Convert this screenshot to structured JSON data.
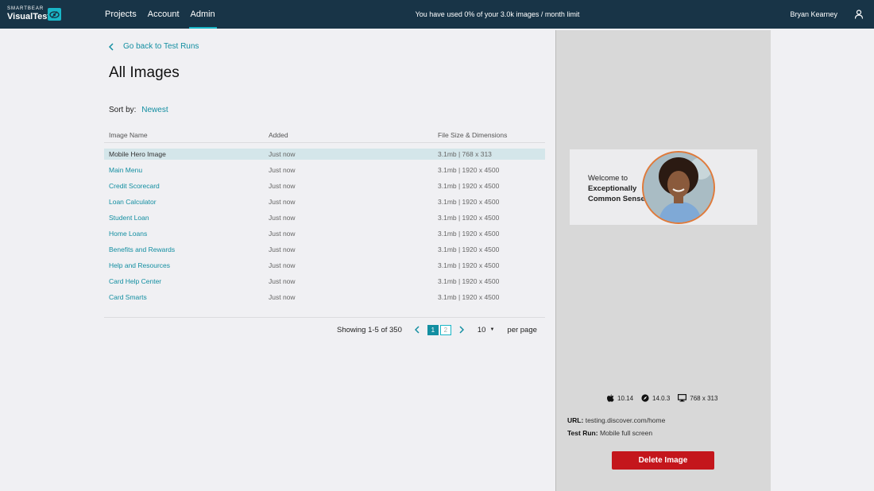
{
  "brand": {
    "small": "SMARTBEAR",
    "big": "VisualTest"
  },
  "nav": [
    {
      "label": "Projects",
      "active": false
    },
    {
      "label": "Account",
      "active": false
    },
    {
      "label": "Admin",
      "active": true
    }
  ],
  "usage_text": "You have used 0% of your 3.0k images / month limit",
  "user": {
    "name": "Bryan Kearney"
  },
  "back_link": "Go back to Test Runs",
  "page_title": "All Images",
  "sort": {
    "label": "Sort by:",
    "value": "Newest"
  },
  "table": {
    "headers": [
      "Image Name",
      "Added",
      "File Size & Dimensions"
    ],
    "rows": [
      {
        "name": "Mobile Hero Image",
        "added": "Just now",
        "size": "3.1mb | 768 x 313",
        "selected": true
      },
      {
        "name": "Main Menu",
        "added": "Just now",
        "size": "3.1mb | 1920 x 4500",
        "selected": false
      },
      {
        "name": "Credit Scorecard",
        "added": "Just now",
        "size": "3.1mb | 1920 x 4500",
        "selected": false
      },
      {
        "name": "Loan Calculator",
        "added": "Just now",
        "size": "3.1mb | 1920 x 4500",
        "selected": false
      },
      {
        "name": "Student Loan",
        "added": "Just now",
        "size": "3.1mb | 1920 x 4500",
        "selected": false
      },
      {
        "name": "Home Loans",
        "added": "Just now",
        "size": "3.1mb | 1920 x 4500",
        "selected": false
      },
      {
        "name": "Benefits and Rewards",
        "added": "Just now",
        "size": "3.1mb | 1920 x 4500",
        "selected": false
      },
      {
        "name": "Help and Resources",
        "added": "Just now",
        "size": "3.1mb | 1920 x 4500",
        "selected": false
      },
      {
        "name": "Card Help Center",
        "added": "Just now",
        "size": "3.1mb | 1920 x 4500",
        "selected": false
      },
      {
        "name": "Card Smarts",
        "added": "Just now",
        "size": "3.1mb | 1920 x 4500",
        "selected": false
      }
    ]
  },
  "pagination": {
    "showing": "Showing 1-5 of 350",
    "pages": [
      "1",
      "2"
    ],
    "current_page": "1",
    "per_page_value": "10",
    "per_page_label": "per page"
  },
  "preview": {
    "line1": "Welcome to",
    "line2": "Exceptionally",
    "line3": "Common Sense",
    "accent_color": "#e07a3a"
  },
  "environment": {
    "os_version": "10.14",
    "browser_version": "14.0.3",
    "viewport": "768 x 313",
    "icons": [
      "apple-icon",
      "safari-icon",
      "monitor-icon"
    ]
  },
  "details": {
    "url_label": "URL",
    "url_value": "testing.discover.com/home",
    "test_run_label": "Test Run",
    "test_run_value": "Mobile full screen"
  },
  "delete_button": "Delete Image",
  "colors": {
    "topbar": "#183447",
    "accent": "#19b6c7",
    "link": "#128ea1",
    "danger": "#c4161c",
    "selected_row": "#d4e6ea"
  }
}
